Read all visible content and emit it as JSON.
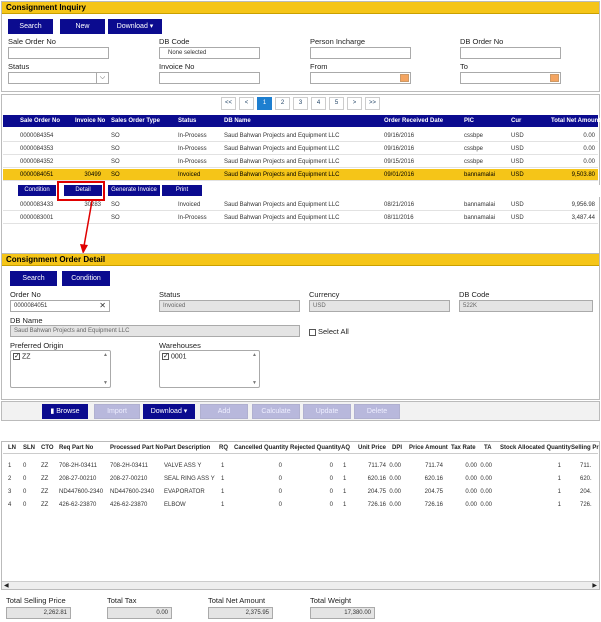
{
  "inquiry": {
    "title": "Consignment Inquiry",
    "buttons": {
      "search": "Search",
      "new": "New",
      "download": "Download ▾"
    },
    "fields": {
      "sale_order_no": "Sale Order No",
      "db_code": "DB Code",
      "db_code_value": "None selected",
      "person_incharge": "Person Incharge",
      "db_order_no": "DB Order No",
      "status": "Status",
      "invoice_no": "Invoice No",
      "from": "From",
      "to": "To"
    },
    "pagination": [
      "<<",
      "<",
      "1",
      "2",
      "3",
      "4",
      "5",
      ">",
      ">>"
    ],
    "columns": [
      "Sale Order No",
      "Invoice No",
      "Sales Order Type",
      "Status",
      "DB Name",
      "Order Received Date",
      "PIC",
      "Cur",
      "Total Net Amount"
    ],
    "rows": [
      [
        "0000084354",
        "",
        "SO",
        "In-Process",
        "Saud Bahwan Projects and Equipment LLC",
        "09/16/2016",
        "cssbpe",
        "USD",
        "0.00"
      ],
      [
        "0000084353",
        "",
        "SO",
        "In-Process",
        "Saud Bahwan Projects and Equipment LLC",
        "09/16/2016",
        "cssbpe",
        "USD",
        "0.00"
      ],
      [
        "0000084352",
        "",
        "SO",
        "In-Process",
        "Saud Bahwan Projects and Equipment LLC",
        "09/15/2016",
        "cssbpe",
        "USD",
        "0.00"
      ],
      [
        "0000084051",
        "30499",
        "SO",
        "Invoiced",
        "Saud Bahwan Projects and Equipment LLC",
        "09/01/2016",
        "bannamalai",
        "USD",
        "9,503.80"
      ]
    ],
    "row_actions": [
      "Condition",
      "Detail",
      "Generate Invoice",
      "Print"
    ],
    "rows_after": [
      [
        "0000083433",
        "30283",
        "SO",
        "Invoiced",
        "Saud Bahwan Projects and Equipment LLC",
        "08/21/2016",
        "bannamalai",
        "USD",
        "9,956.98"
      ],
      [
        "0000083001",
        "",
        "SO",
        "In-Process",
        "Saud Bahwan Projects and Equipment LLC",
        "08/11/2016",
        "bannamalai",
        "USD",
        "3,487.44"
      ]
    ]
  },
  "detail": {
    "title": "Consignment Order Detail",
    "buttons": {
      "search": "Search",
      "condition": "Condition"
    },
    "order_no_label": "Order No",
    "order_no_value": "0000084051",
    "status_label": "Status",
    "status_value": "Invoiced",
    "currency_label": "Currency",
    "currency_value": "USD",
    "db_code_label": "DB Code",
    "db_code_value": "522K",
    "db_name_label": "DB Name",
    "db_name_value": "Saud Bahwan Projects and Equipment LLC",
    "select_all": "Select All",
    "preferred_origin_label": "Preferred Origin",
    "preferred_origin_item": "ZZ",
    "warehouses_label": "Warehouses",
    "warehouses_item": "0001",
    "toolbar": [
      "Browse",
      "Import",
      "Download ▾",
      "Add",
      "Calculate",
      "Update",
      "Delete"
    ],
    "columns": [
      "LN",
      "SLN",
      "CTO",
      "Req Part No",
      "Processed Part No",
      "Part Description",
      "RQ",
      "Cancelled Quantity",
      "Rejected Quantity",
      "AQ",
      "Unit Price",
      "DPI",
      "Price Amount",
      "Tax Rate",
      "TA",
      "Stock Allocated Quantity",
      "Selling Pr"
    ],
    "rows": [
      [
        "1",
        "0",
        "ZZ",
        "708-2H-03411",
        "708-2H-03411",
        "VALVE ASS Y",
        "1",
        "0",
        "0",
        "1",
        "711.74",
        "0.00",
        "711.74",
        "0.00",
        "0.00",
        "1",
        "711."
      ],
      [
        "2",
        "0",
        "ZZ",
        "208-27-00210",
        "208-27-00210",
        "SEAL RING ASS Y",
        "1",
        "0",
        "0",
        "1",
        "620.16",
        "0.00",
        "620.16",
        "0.00",
        "0.00",
        "1",
        "620."
      ],
      [
        "3",
        "0",
        "ZZ",
        "ND447600-2340",
        "ND447600-2340",
        "EVAPORATOR",
        "1",
        "0",
        "0",
        "1",
        "204.75",
        "0.00",
        "204.75",
        "0.00",
        "0.00",
        "1",
        "204."
      ],
      [
        "4",
        "0",
        "ZZ",
        "426-62-23870",
        "426-62-23870",
        "ELBOW",
        "1",
        "0",
        "0",
        "1",
        "726.16",
        "0.00",
        "726.16",
        "0.00",
        "0.00",
        "1",
        "726."
      ]
    ],
    "totals": [
      {
        "label": "Total Selling Price",
        "value": "2,262.81"
      },
      {
        "label": "Total Tax",
        "value": "0.00"
      },
      {
        "label": "Total Net Amount",
        "value": "2,375.95"
      },
      {
        "label": "Total Weight",
        "value": "17,380.00"
      }
    ]
  },
  "colors": {
    "header": "#f5c518",
    "button": "#0b0b8f",
    "highlight_box": "#e00000",
    "page_active": "#1e7fd0"
  }
}
